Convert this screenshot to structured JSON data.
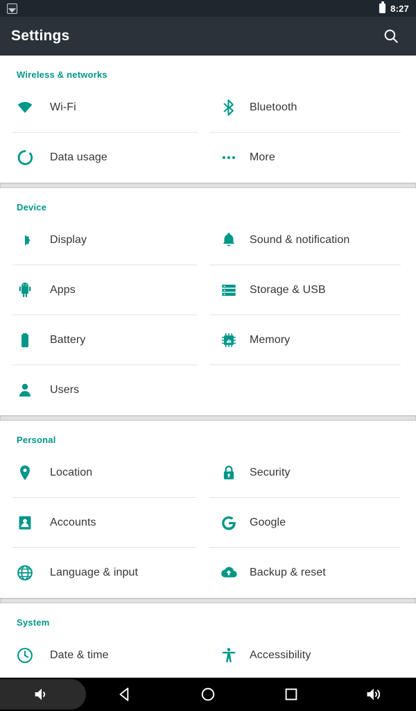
{
  "status_bar": {
    "left_icon": "screenshot-icon",
    "battery_icon": "battery-full-icon",
    "time": "8:27"
  },
  "app_bar": {
    "title": "Settings",
    "search_icon": "search-icon"
  },
  "colors": {
    "accent": "#009688",
    "app_bar": "#2a323a",
    "status_bar": "#1f272e",
    "label": "#353535",
    "divider": "#e4e4e4",
    "section_gap": "#e2e2e2"
  },
  "sections": [
    {
      "header": "Wireless & networks",
      "items": [
        {
          "label": "Wi-Fi",
          "icon": "wifi-icon"
        },
        {
          "label": "Bluetooth",
          "icon": "bluetooth-icon"
        },
        {
          "label": "Data usage",
          "icon": "data-usage-icon"
        },
        {
          "label": "More",
          "icon": "more-horizontal-icon"
        }
      ]
    },
    {
      "header": "Device",
      "items": [
        {
          "label": "Display",
          "icon": "brightness-icon"
        },
        {
          "label": "Sound & notification",
          "icon": "bell-icon"
        },
        {
          "label": "Apps",
          "icon": "android-icon"
        },
        {
          "label": "Storage & USB",
          "icon": "storage-icon"
        },
        {
          "label": "Battery",
          "icon": "battery-icon"
        },
        {
          "label": "Memory",
          "icon": "memory-chip-icon"
        },
        {
          "label": "Users",
          "icon": "person-icon"
        },
        {
          "label": "",
          "icon": ""
        }
      ]
    },
    {
      "header": "Personal",
      "items": [
        {
          "label": "Location",
          "icon": "location-pin-icon"
        },
        {
          "label": "Security",
          "icon": "lock-icon"
        },
        {
          "label": "Accounts",
          "icon": "account-card-icon"
        },
        {
          "label": "Google",
          "icon": "google-g-icon"
        },
        {
          "label": "Language & input",
          "icon": "globe-icon"
        },
        {
          "label": "Backup & reset",
          "icon": "cloud-upload-icon"
        }
      ]
    },
    {
      "header": "System",
      "items": [
        {
          "label": "Date & time",
          "icon": "clock-icon"
        },
        {
          "label": "Accessibility",
          "icon": "accessibility-icon"
        }
      ]
    }
  ],
  "nav_bar": {
    "buttons": [
      {
        "name": "volume-down-button",
        "icon": "volume-down-icon"
      },
      {
        "name": "back-button",
        "icon": "back-triangle-icon"
      },
      {
        "name": "home-button",
        "icon": "home-circle-icon"
      },
      {
        "name": "recents-button",
        "icon": "recents-square-icon"
      },
      {
        "name": "volume-up-button",
        "icon": "volume-up-icon"
      }
    ]
  }
}
